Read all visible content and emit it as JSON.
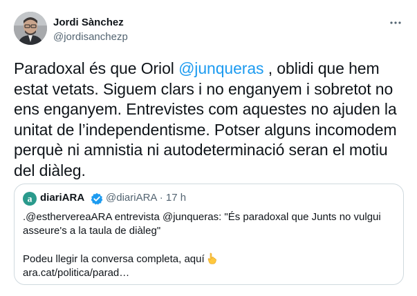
{
  "author": {
    "name": "Jordi Sànchez",
    "handle": "@jordisanchezp"
  },
  "more_label": "···",
  "tweet": {
    "before_mention": "Paradoxal és que Oriol ",
    "mention": "@junqueras",
    "after_mention": " , oblidi que hem estat vetats. Siguem clars i no enganyem i sobretot no ens enganyem. Entrevistes com aquestes no ajuden la unitat de l’independentisme. Potser alguns incomodem perquè ni amnistia ni autodeterminació seran el motiu del diàleg."
  },
  "quote": {
    "name": "diariARA",
    "handle_time": "@diariARA · 17 h",
    "text": ".@esthervereaARA entrevista @junqueras: \"És paradoxal que Junts no vulgui asseure's a la taula de diàleg\"",
    "line2": "Podeu llegir la conversa completa, aquí",
    "link": "ara.cat/politica/parad…",
    "emoji": "pointing-down-hand"
  },
  "colors": {
    "accent": "#1d9bf0",
    "text": "#0f1419",
    "secondary": "#536471",
    "border": "#cfd9de",
    "brand_ara": "#2a9a8c"
  }
}
